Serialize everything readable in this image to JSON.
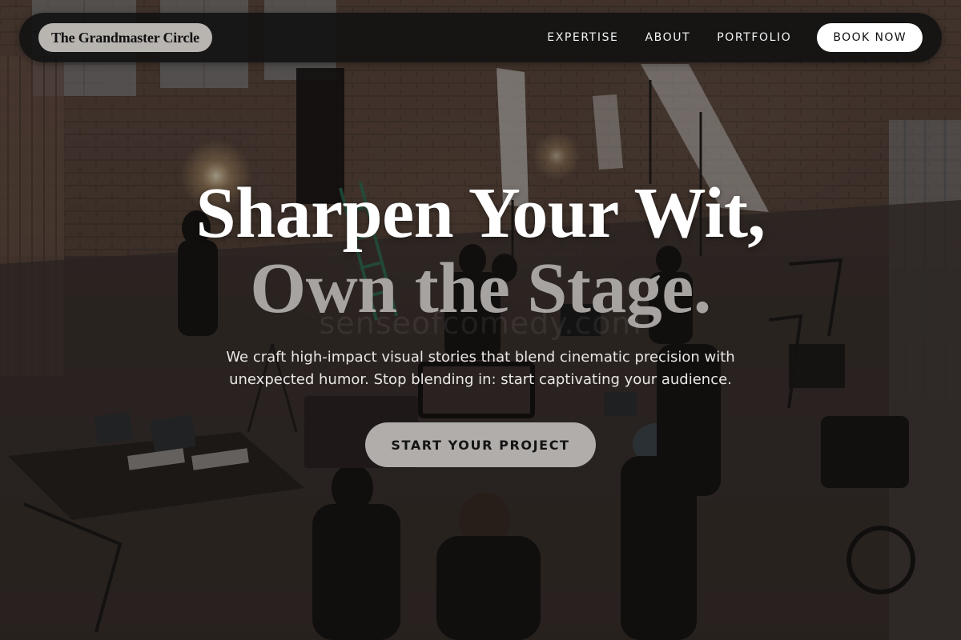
{
  "nav": {
    "brand": "The Grandmaster Circle",
    "links": [
      "EXPERTISE",
      "ABOUT",
      "PORTFOLIO"
    ],
    "book_label": "BOOK NOW"
  },
  "hero": {
    "headline_line1": "Sharpen Your Wit,",
    "headline_line2": "Own the Stage.",
    "watermark": "senseofcomedy.com",
    "subtitle": "We craft high-impact visual stories that blend cinematic precision with unexpected humor. Stop blending in: start captivating your audience.",
    "cta_label": "START YOUR PROJECT"
  },
  "colors": {
    "nav_bg": "#121212",
    "brand_pill": "#b8b4b0",
    "headline_primary": "#ffffff",
    "headline_secondary": "#a6a3a0",
    "cta_bg": "#b1adaa"
  }
}
